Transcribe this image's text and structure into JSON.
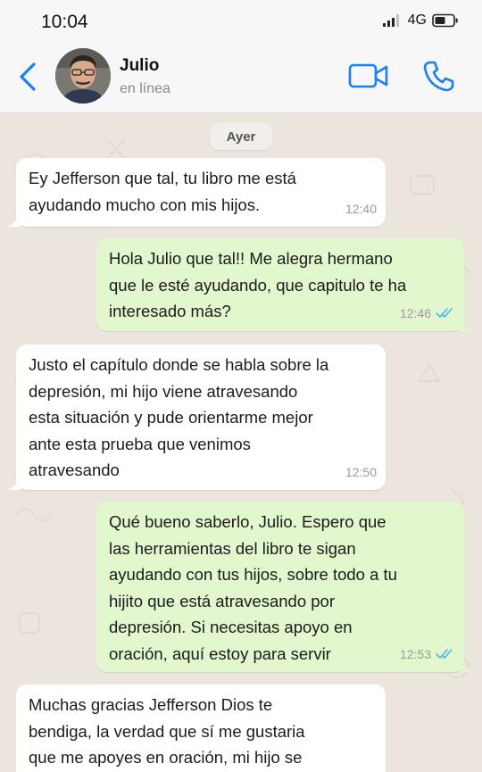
{
  "status_bar": {
    "time": "10:04",
    "network": "4G"
  },
  "header": {
    "contact_name": "Julio",
    "contact_status": "en línea"
  },
  "chat": {
    "day_label": "Ayer",
    "messages": [
      {
        "direction": "in",
        "text": "Ey Jefferson que tal, tu libro me está\nayudando mucho con mis hijos.",
        "time": "12:40"
      },
      {
        "direction": "out",
        "text": "Hola Julio que tal!! Me alegra hermano\nque le esté ayudando, que capitulo te ha\ninteresado más?",
        "time": "12:46",
        "status": "read"
      },
      {
        "direction": "in",
        "text": "Justo el capítulo donde se habla sobre la\ndepresión, mi hijo viene atravesando\nesta situación y pude orientarme mejor\nante esta prueba que venimos\natravesando",
        "time": "12:50"
      },
      {
        "direction": "out",
        "text": "Qué bueno saberlo, Julio. Espero que\nlas herramientas del libro te sigan\nayudando con tus hijos, sobre todo a tu\nhijito que está atravesando por\ndepresión. Si necesitas apoyo en\noración, aquí estoy para servir",
        "time": "12:53",
        "status": "read"
      },
      {
        "direction": "in",
        "text": "Muchas gracias Jefferson Dios te\nbendiga, la verdad que sí me gustaria\nque me apoyes en oración, mi hijo se",
        "time": ""
      }
    ]
  },
  "colors": {
    "accent": "#1a7ff0",
    "incoming_bubble": "#ffffff",
    "outgoing_bubble": "#e3f7cf",
    "chat_background": "#ebe5dd",
    "read_ticks": "#4fb3f0"
  },
  "icons": {
    "back": "chevron-left-icon",
    "video": "video-call-icon",
    "phone": "phone-call-icon",
    "signal": "signal-bars-icon",
    "battery": "battery-icon",
    "read": "double-check-icon"
  }
}
